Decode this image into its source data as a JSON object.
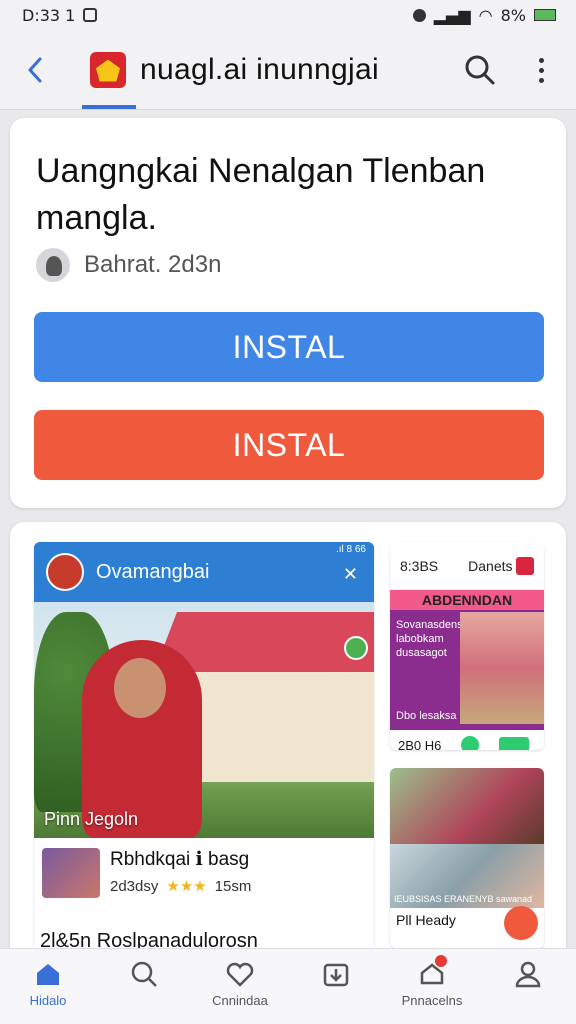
{
  "status_bar": {
    "time": "D:33 1",
    "battery": "8%"
  },
  "app_bar": {
    "title": "nuagl.ai inunngjai"
  },
  "article": {
    "headline": "Uangngkai Nenalgan Tlenban mangla.",
    "author": "Bahrat. 2d3n",
    "install_blue": "INSTAL",
    "install_orange": "INSTAL"
  },
  "preview_main": {
    "header_title": "Ovamangbai",
    "status": ".ıl 8 66",
    "photo_caption": "Pinn Jegoln",
    "info_title": "Rbhdkqai ℹ basg",
    "info_date": "2d3dsy",
    "info_stars": "★★★",
    "info_duration": "15sm",
    "caption": "2l&5n Roslpanadulorosn"
  },
  "preview_side": {
    "time": "8:3BS",
    "title": "Danets",
    "banner": "ABDENNDAN",
    "banner_text": "Sovanasdens labobkam dusasagot",
    "banner_small": "Dbo lesaksa",
    "footer_text": "2B0 H6"
  },
  "preview_side2": {
    "small_text": "IEUBSISAS ERANENYB sawanad",
    "label": "Pll Heady"
  },
  "bottom_nav": [
    {
      "label": "Hidalo",
      "icon": "home-icon",
      "active": true
    },
    {
      "label": "",
      "icon": "search-icon",
      "active": false
    },
    {
      "label": "Cnnindaa",
      "icon": "heart-icon",
      "active": false
    },
    {
      "label": "",
      "icon": "download-icon",
      "active": false
    },
    {
      "label": "Pnnacelns",
      "icon": "notification-icon",
      "active": false
    },
    {
      "label": "",
      "icon": "profile-icon",
      "active": false
    }
  ],
  "colors": {
    "accent_blue": "#3f86e6",
    "accent_orange": "#f05a3c",
    "brand_red": "#d8262c"
  }
}
